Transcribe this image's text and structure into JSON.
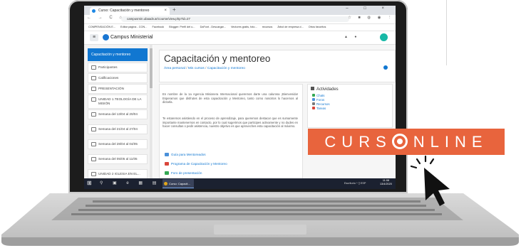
{
  "browser": {
    "tab_title": "Curso: Capacitación y mentoreo",
    "new_tab": "+",
    "window_controls": "– □ ×",
    "nav_buttons": "← → C ⌂",
    "url": "campusmin.ubaadv.ar/course/view.php?id=27",
    "extensions": "☆ ■ ◍ ◉ ⋮",
    "bookmarks": [
      "COMPENSACIÓN E...",
      "Editar página - CON...",
      "Facebook",
      "Blogger: Perfil del u...",
      "DaFont - Descargar...",
      "Vectores gratis, foto...",
      "recursos",
      "Árbol de empresa d...",
      "Otros favoritos"
    ]
  },
  "site": {
    "brand": "Campus Ministerial",
    "header_icons": "▲ ●"
  },
  "drawer": {
    "active": "Capacitación y mentoreo",
    "items": [
      {
        "label": "Participantes"
      },
      {
        "label": "Calificaciones"
      },
      {
        "label": "PRESENTACIÓN"
      },
      {
        "label": "UNIDAD 1.TEOLOGÍA DE LA MISIÓN"
      },
      {
        "label": "Semana del 13/04 al 20/04"
      },
      {
        "label": "Semana del 21/04 al 27/04"
      },
      {
        "label": "Semana del 28/04 al 04/05"
      },
      {
        "label": "Semana del 05/05 al 11/05"
      },
      {
        "label": "UNIDAD 2 IGLESIA EN EL..."
      }
    ]
  },
  "main": {
    "title": "Capacitación y mentoreo",
    "breadcrumb": [
      "Área personal",
      "Mis cursos",
      "Capacitación y mentoreo"
    ],
    "breadcrumb_sep": "/",
    "paragraphs": [
      "En nombre de la 1a Agencia Misionera Internacional queremos darte una calurosa ¡Bienvenida! Esperamos que disfrutes de esta capacitación y Mentoreo, tanto como nosotros lo hacemos al dictarla.",
      "Te estaremos asistiendo en el proceso de aprendizaje, para queremos destacar que es sumamente importante mantenernos en contacto, por lo cual sugerimos que participes activamente y no dudes en hacer consultas o pedir asistencia, nuestro objetivo es que aproveches esta capacitación al máximo."
    ],
    "links": [
      "Guía para Mentoreados",
      "Programa de Capacitación y Mentoreo",
      "Foro de presentación"
    ]
  },
  "activities": {
    "title": "Actividades",
    "items": [
      "Chats",
      "Foros",
      "Recursos",
      "Tareas"
    ]
  },
  "taskbar": {
    "start": "⊞",
    "icons": "⚲ ▣ e ▦ ▤",
    "app_label": "Curso: Capacit...",
    "tray": "Escritorio  ^  ▯  ESP",
    "time": "11:08",
    "date": "13/4/2020"
  },
  "banner": {
    "text_before": "CURS",
    "text_after": "NLINE"
  },
  "colors": {
    "accent": "#1177d1",
    "banner": "#e8643d",
    "taskbar": "#1b2130",
    "avatar": "#17b8a6"
  }
}
